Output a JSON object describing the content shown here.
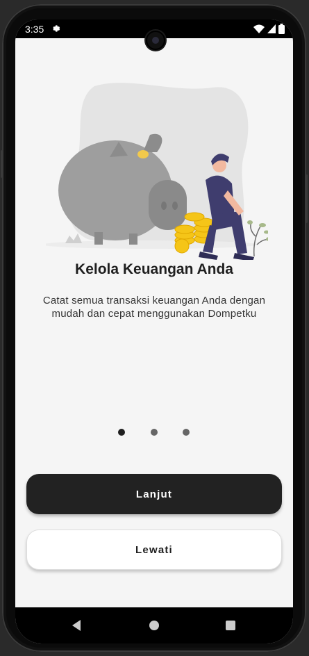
{
  "status_bar": {
    "time": "3:35",
    "icons": [
      "settings-icon",
      "wifi-icon",
      "signal-icon",
      "battery-icon"
    ]
  },
  "onboarding": {
    "illustration": "piggy-bank-illustration",
    "title": "Kelola Keuangan Anda",
    "description": "Catat semua transaksi keuangan Anda dengan mudah dan cepat menggunakan Dompetku",
    "page_indicator": {
      "total": 3,
      "current": 1
    }
  },
  "buttons": {
    "next_label": "Lanjut",
    "skip_label": "Lewati"
  },
  "nav_bar": {
    "icons": [
      "back-icon",
      "home-icon",
      "recents-icon"
    ]
  },
  "colors": {
    "primary": "#222222",
    "background": "#f5f5f5",
    "accent_figure": "#3f3d6e",
    "coin": "#f5c518"
  }
}
